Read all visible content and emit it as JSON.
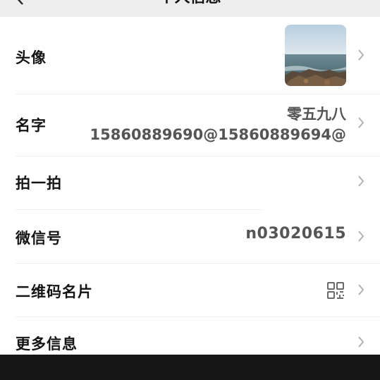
{
  "header": {
    "title": "个人信息"
  },
  "rows": {
    "avatar": {
      "label": "头像"
    },
    "name": {
      "label": "名字",
      "value_line1": "零五九八",
      "value_line2": "15860889690@15860889694@"
    },
    "pat": {
      "label": "拍一拍"
    },
    "wechat_id": {
      "label": "微信号",
      "value": "n03020615"
    },
    "qr_card": {
      "label": "二维码名片"
    },
    "more_info": {
      "label": "更多信息"
    }
  },
  "icons": {
    "back": "chevron-left-icon",
    "chevron": "chevron-right-icon",
    "qr": "qr-code-icon"
  },
  "colors": {
    "nav_background": "#ededed",
    "label": "#141414",
    "value": "#555555",
    "chevron": "#b2b2b2",
    "bottom_bar": "#161616"
  }
}
